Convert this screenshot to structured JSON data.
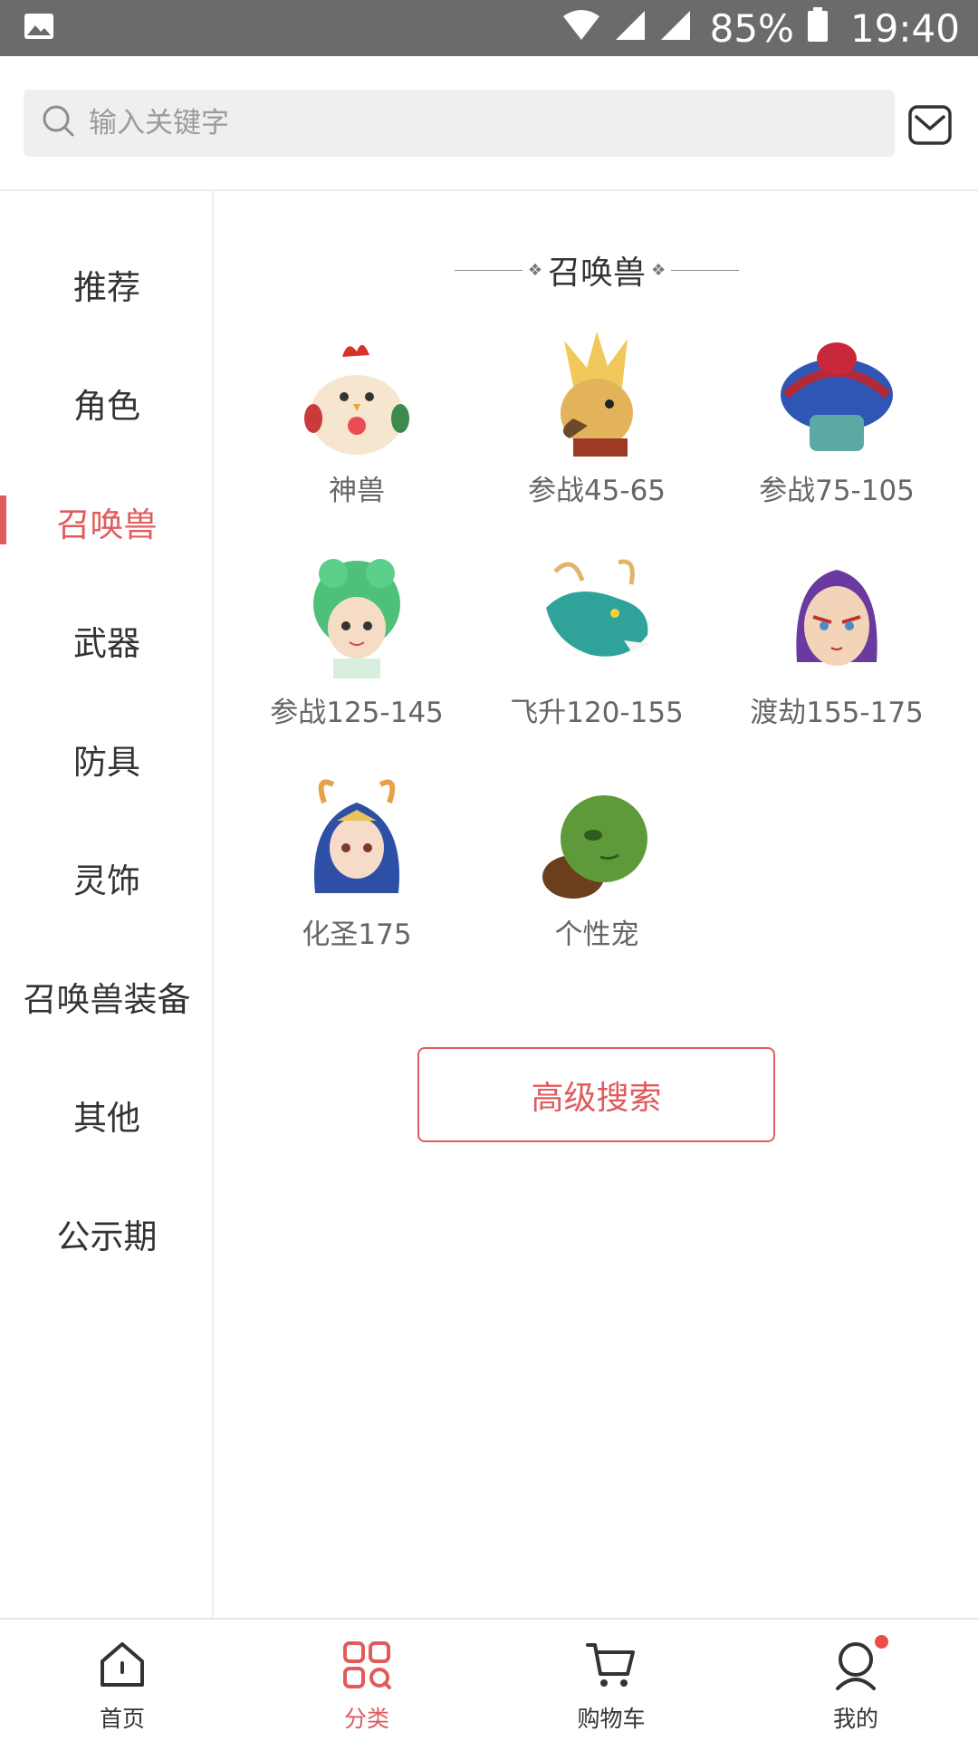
{
  "status_bar": {
    "battery_percent": "85%",
    "time": "19:40",
    "icons": [
      "image-icon",
      "wifi-icon",
      "signal-icon",
      "signal-icon",
      "battery-icon"
    ]
  },
  "search": {
    "placeholder": "输入关键字",
    "icons": [
      "search-icon",
      "mail-icon"
    ]
  },
  "sidebar": {
    "items": [
      {
        "label": "推荐"
      },
      {
        "label": "角色"
      },
      {
        "label": "召唤兽",
        "active": true
      },
      {
        "label": "武器"
      },
      {
        "label": "防具"
      },
      {
        "label": "灵饰"
      },
      {
        "label": "召唤兽装备"
      },
      {
        "label": "其他"
      },
      {
        "label": "公示期"
      }
    ]
  },
  "main": {
    "section_title": "召唤兽",
    "items": [
      {
        "label": "神兽",
        "icon": "chicken-pet-icon"
      },
      {
        "label": "参战45-65",
        "icon": "eagle-warrior-icon"
      },
      {
        "label": "参战75-105",
        "icon": "umbrella-creature-icon"
      },
      {
        "label": "参战125-145",
        "icon": "green-hair-girl-icon"
      },
      {
        "label": "飞升120-155",
        "icon": "dragon-icon"
      },
      {
        "label": "渡劫155-175",
        "icon": "painted-face-warrior-icon"
      },
      {
        "label": "化圣175",
        "icon": "antler-goddess-icon"
      },
      {
        "label": "个性宠",
        "icon": "turtle-icon"
      }
    ],
    "advanced_search_label": "高级搜索"
  },
  "tabbar": {
    "tabs": [
      {
        "label": "首页",
        "icon": "home-icon"
      },
      {
        "label": "分类",
        "icon": "category-icon",
        "active": true
      },
      {
        "label": "购物车",
        "icon": "cart-icon"
      },
      {
        "label": "我的",
        "icon": "profile-icon",
        "has_badge": true
      }
    ]
  },
  "colors": {
    "accent": "#e15b5b",
    "status_bar": "#6b6b6b",
    "search_bg": "#efefef"
  }
}
